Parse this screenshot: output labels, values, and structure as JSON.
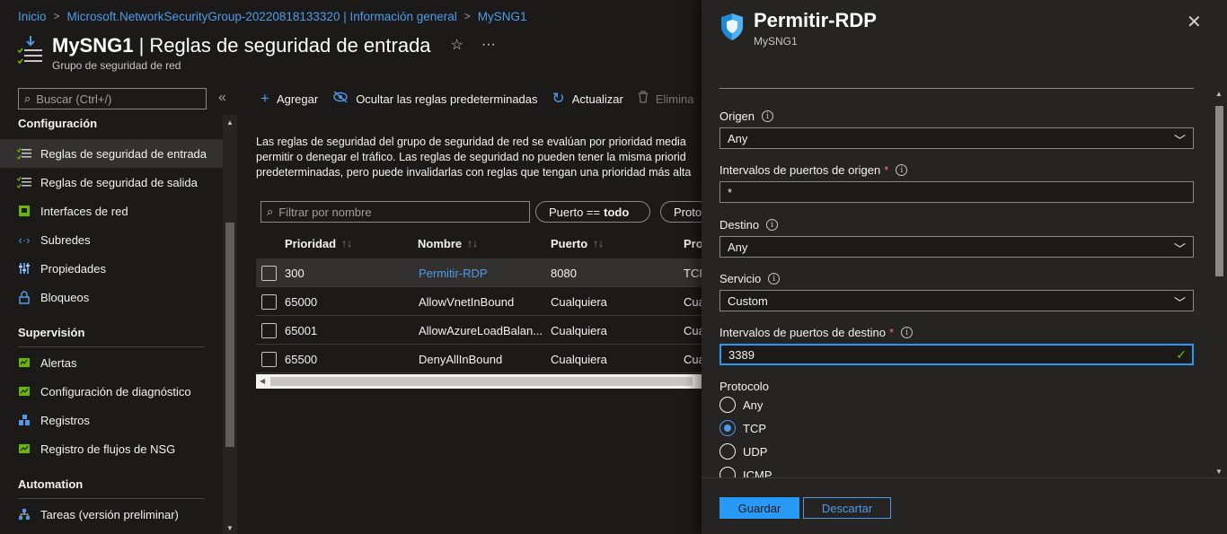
{
  "breadcrumb": {
    "items": [
      "Inicio",
      "Microsoft.NetworkSecurityGroup-20220818133320 | Información general",
      "MySNG1"
    ],
    "separator": ">"
  },
  "header": {
    "title_bold": "MySNG1",
    "title_rest": " | Reglas de seguridad de entrada",
    "subtitle": "Grupo de seguridad de red",
    "favorite_icon": "☆",
    "more_icon": "···"
  },
  "sidebar": {
    "search_placeholder": "Buscar (Ctrl+/)",
    "collapse_icon": "«",
    "sections": [
      {
        "title": "Configuración",
        "items": [
          {
            "label": "Reglas de seguridad de entrada",
            "icon": "inbound-rules-icon",
            "active": true
          },
          {
            "label": "Reglas de seguridad de salida",
            "icon": "outbound-rules-icon"
          },
          {
            "label": "Interfaces de red",
            "icon": "network-interface-icon"
          },
          {
            "label": "Subredes",
            "icon": "subnet-icon"
          },
          {
            "label": "Propiedades",
            "icon": "properties-icon"
          },
          {
            "label": "Bloqueos",
            "icon": "lock-icon"
          }
        ]
      },
      {
        "title": "Supervisión",
        "items": [
          {
            "label": "Alertas",
            "icon": "alerts-icon"
          },
          {
            "label": "Configuración de diagnóstico",
            "icon": "diagnostic-settings-icon"
          },
          {
            "label": "Registros",
            "icon": "logs-icon"
          },
          {
            "label": "Registro de flujos de NSG",
            "icon": "flow-logs-icon"
          }
        ]
      },
      {
        "title": "Automation",
        "items": [
          {
            "label": "Tareas (versión preliminar)",
            "icon": "tasks-icon"
          }
        ]
      }
    ]
  },
  "toolbar": {
    "add": "Agregar",
    "hide_defaults": "Ocultar las reglas predeterminadas",
    "refresh": "Actualizar",
    "delete": "Elimina"
  },
  "description": {
    "line1": "Las reglas de seguridad del grupo de seguridad de red se evalúan por prioridad media",
    "line2": "permitir o denegar el tráfico. Las reglas de seguridad no pueden tener la misma priorid",
    "line3": "predeterminadas, pero puede invalidarlas con reglas que tengan una prioridad más alta"
  },
  "filter": {
    "placeholder": "Filtrar por nombre",
    "pill_port_label": "Puerto ==",
    "pill_port_value": "todo",
    "pill_protocol": "Proto"
  },
  "table": {
    "headers": [
      "Prioridad",
      "Nombre",
      "Puerto",
      "Pro"
    ],
    "sort_icon": "↑↓",
    "rows": [
      {
        "priority": "300",
        "name": "Permitir-RDP",
        "port": "8080",
        "protocol": "TCP",
        "selected": true,
        "link": true
      },
      {
        "priority": "65000",
        "name": "AllowVnetInBound",
        "port": "Cualquiera",
        "protocol": "Cua"
      },
      {
        "priority": "65001",
        "name": "AllowAzureLoadBalan...",
        "port": "Cualquiera",
        "protocol": "Cua"
      },
      {
        "priority": "65500",
        "name": "DenyAllInBound",
        "port": "Cualquiera",
        "protocol": "Cua"
      }
    ]
  },
  "panel": {
    "title": "Permitir-RDP",
    "subtitle": "MySNG1",
    "close_icon": "✕",
    "fields": {
      "origen_label": "Origen",
      "origen_value": "Any",
      "src_ports_label": "Intervalos de puertos de origen",
      "src_ports_value": "*",
      "destino_label": "Destino",
      "destino_value": "Any",
      "servicio_label": "Servicio",
      "servicio_value": "Custom",
      "dst_ports_label": "Intervalos de puertos de destino",
      "dst_ports_value": "3389",
      "protocolo_label": "Protocolo"
    },
    "required_mark": "*",
    "info_mark": "i",
    "protocol_options": [
      "Any",
      "TCP",
      "UDP",
      "ICMP"
    ],
    "protocol_selected": "TCP",
    "save": "Guardar",
    "discard": "Descartar"
  },
  "colors": {
    "accent": "#2899f5",
    "link": "#4f9bea",
    "background": "#1b1a19",
    "panel": "#252423",
    "required": "#f1707b",
    "valid": "#6bb700"
  }
}
